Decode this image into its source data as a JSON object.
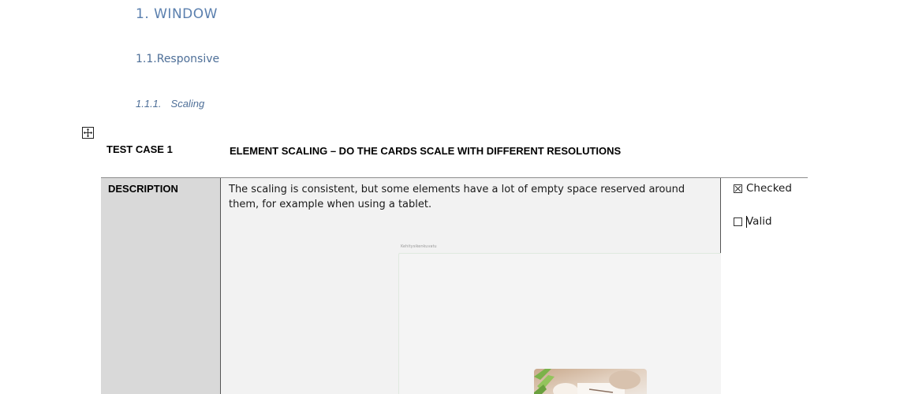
{
  "headings": {
    "h1": "1.  WINDOW",
    "h2": "1.1.Responsive",
    "h3_number": "1.1.1.",
    "h3_text": "Scaling"
  },
  "test_case": {
    "label": "TEST CASE 1",
    "title": "ELEMENT SCALING – DO THE CARDS SCALE WITH DIFFERENT RESOLUTIONS"
  },
  "table": {
    "description_label": "DESCRIPTION",
    "description_text": "The scaling is consistent, but some elements have a lot of empty space reserved around them, for example when using a tablet.",
    "embedded_image_caption": "Kehitysikenkuvatu",
    "status": [
      {
        "label": "Checked",
        "checked": true
      },
      {
        "label": "Valid",
        "checked": false
      }
    ]
  },
  "icons": {
    "table_move_handle": "table-move-handle-icon",
    "checked_box": "checkbox-crossed-icon",
    "unchecked_box": "checkbox-empty-icon"
  },
  "colors": {
    "heading_blue": "#5a7fae",
    "label_cell_gray": "#d9d9d9",
    "content_cell_gray": "#f2f2f2"
  }
}
